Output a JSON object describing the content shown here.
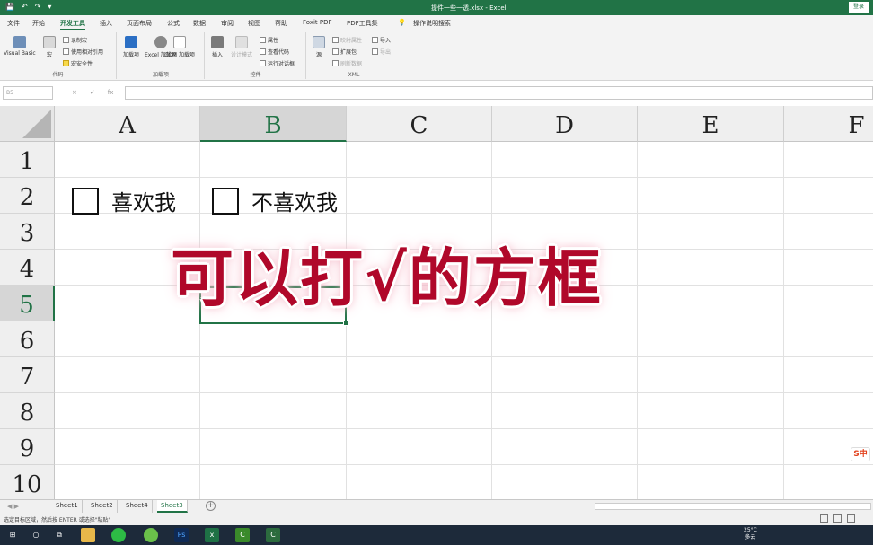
{
  "window": {
    "title": "提件一些一透.xlsx - Excel",
    "login_label": "登录",
    "accent": "#217346"
  },
  "ribbon_tabs": [
    "文件",
    "开始",
    "开发工具",
    "插入",
    "页面布局",
    "公式",
    "数据",
    "审阅",
    "视图",
    "帮助",
    "Foxit PDF",
    "PDF工具集",
    "操作说明搜索"
  ],
  "active_tab": "开发工具",
  "ribbon": {
    "code": {
      "name": "代码",
      "visual_basic": "Visual Basic",
      "macros": "宏",
      "record_macro": "录制宏",
      "relative_refs": "使用相对引用",
      "macro_security": "宏安全性"
    },
    "addins": {
      "name": "加载项",
      "addins": "加载项",
      "excel_addins": "Excel 加载项",
      "com_addins": "COM 加载项"
    },
    "controls": {
      "name": "控件",
      "insert": "插入",
      "design_mode": "设计模式",
      "properties": "属性",
      "view_code": "查看代码",
      "run_dialog": "运行对话框"
    },
    "xml": {
      "name": "XML",
      "source": "源",
      "map_properties": "映射属性",
      "expansion_packs": "扩展包",
      "refresh_data": "刷新数据",
      "import": "导入",
      "export": "导出"
    }
  },
  "formula_bar": {
    "name_box": "B5",
    "cancel": "×",
    "enter": "✓",
    "fx": "fx",
    "value": ""
  },
  "columns": [
    "A",
    "B",
    "C",
    "D",
    "E",
    "F"
  ],
  "rows": [
    "1",
    "2",
    "3",
    "4",
    "5",
    "6",
    "7",
    "8",
    "9",
    "10"
  ],
  "selected_cell": "B5",
  "cells": {
    "a2_label": "喜欢我",
    "b2_label": "不喜欢我"
  },
  "overlay_text": "可以打√的方框",
  "overlay_color": "#b0082a",
  "ime_badge": "S中",
  "sheet_tabs": [
    "Sheet1",
    "Sheet2",
    "Sheet4",
    "Sheet3"
  ],
  "active_sheet": "Sheet3",
  "status_message": "选定目标区域，然后按 ENTER 或选择\"粘贴\"",
  "taskbar": {
    "temperature": "25°C",
    "weather": "多云",
    "apps": [
      "start-icon",
      "search-icon",
      "task-view-icon",
      "file-explorer-icon",
      "wechat-icon",
      "browser-icon",
      "photoshop-icon",
      "excel-icon",
      "camtasia-icon",
      "camtasia-recorder-icon"
    ]
  }
}
